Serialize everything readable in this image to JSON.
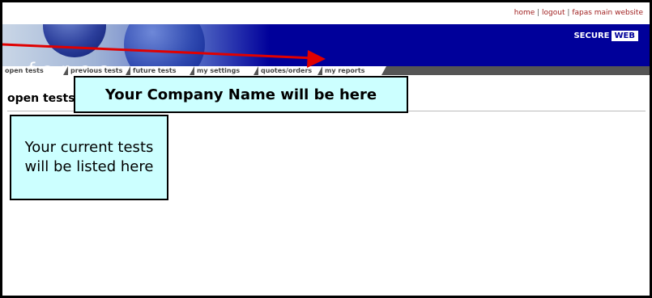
{
  "header": {
    "links": [
      "home",
      "logout",
      "fapas main website"
    ],
    "separator": "|",
    "logo": "fapas",
    "secure_label": "SECURE",
    "secure_badge": "WEB"
  },
  "tabs": [
    {
      "label": "open tests"
    },
    {
      "label": "previous tests"
    },
    {
      "label": "future tests"
    },
    {
      "label": "my settings"
    },
    {
      "label": "quotes/orders"
    },
    {
      "label": "my reports"
    }
  ],
  "main": {
    "section_title": "open tests"
  },
  "callouts": {
    "company": "Your Company Name will be here",
    "tests": "Your current tests will be listed here"
  },
  "colors": {
    "banner": "#00009a",
    "callout_fill": "#ccffff",
    "arrow": "#e00000",
    "link": "#a02020"
  }
}
